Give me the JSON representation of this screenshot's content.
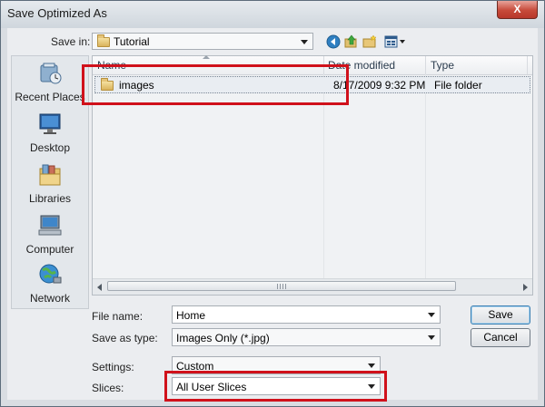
{
  "window": {
    "title": "Save Optimized As",
    "close": "X"
  },
  "top": {
    "save_in_label": "Save in:",
    "save_in_value": "Tutorial"
  },
  "places": [
    {
      "label": "Recent Places",
      "icon": "recent-places-icon"
    },
    {
      "label": "Desktop",
      "icon": "desktop-icon"
    },
    {
      "label": "Libraries",
      "icon": "libraries-icon"
    },
    {
      "label": "Computer",
      "icon": "computer-icon"
    },
    {
      "label": "Network",
      "icon": "network-icon"
    }
  ],
  "filelist": {
    "columns": [
      "Name",
      "Date modified",
      "Type"
    ],
    "rows": [
      {
        "name": "images",
        "date": "8/17/2009 9:32 PM",
        "type": "File folder"
      }
    ]
  },
  "form": {
    "file_name_label": "File name:",
    "file_name_value": "Home",
    "save_as_type_label": "Save as type:",
    "save_as_type_value": "Images Only (*.jpg)",
    "settings_label": "Settings:",
    "settings_value": "Custom",
    "slices_label": "Slices:",
    "slices_value": "All User Slices"
  },
  "buttons": {
    "save": "Save",
    "cancel": "Cancel"
  },
  "colors": {
    "highlight": "#d0111b",
    "title_bar": "#cfd6dd",
    "close": "#c74a3a"
  }
}
